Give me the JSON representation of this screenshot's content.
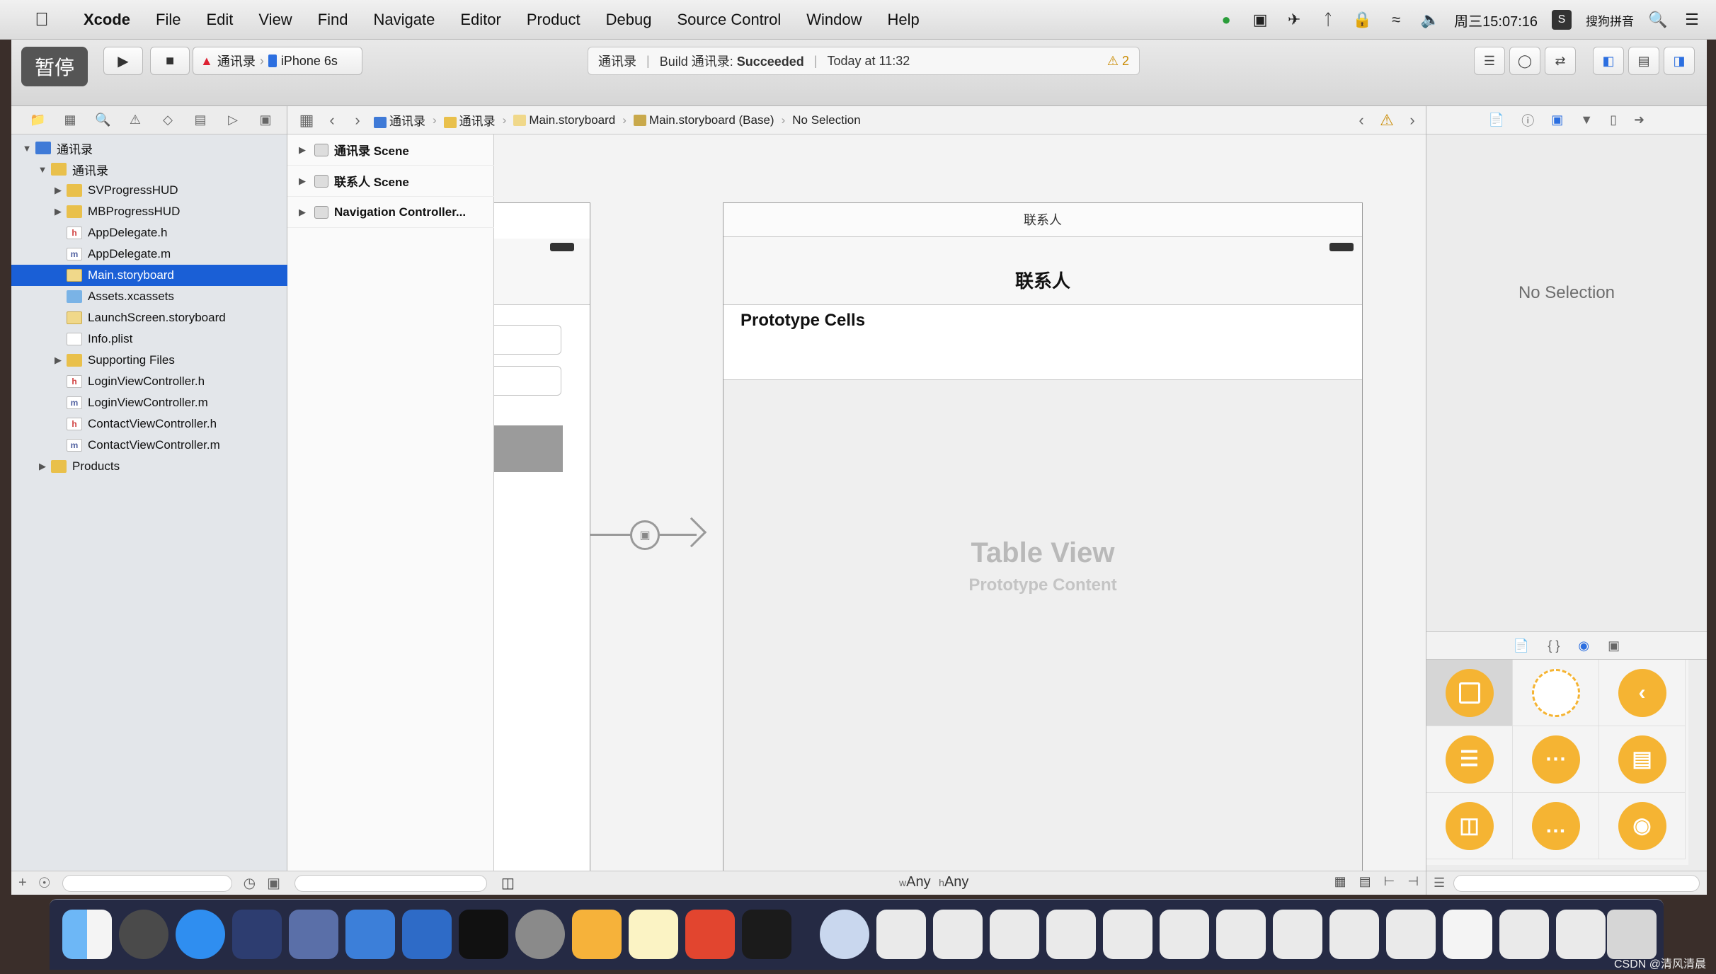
{
  "menubar": {
    "app": "Xcode",
    "menus": [
      "File",
      "Edit",
      "View",
      "Find",
      "Navigate",
      "Editor",
      "Product",
      "Debug",
      "Source Control",
      "Window",
      "Help"
    ],
    "clock": "周三15:07:16",
    "input_method": "搜狗拼音"
  },
  "toolbar": {
    "pause_label": "暂停",
    "scheme": "通讯录",
    "device": "iPhone 6s",
    "activity_project": "通讯录",
    "activity_build_prefix": "Build 通讯录:",
    "activity_status": "Succeeded",
    "activity_time": "Today at 11:32",
    "warning_count": "2"
  },
  "navigator": {
    "items": [
      {
        "label": "通讯录",
        "kind": "proj",
        "level": 0,
        "expanded": true
      },
      {
        "label": "通讯录",
        "kind": "folder",
        "level": 1,
        "expanded": true
      },
      {
        "label": "SVProgressHUD",
        "kind": "folder",
        "level": 2,
        "expanded": false
      },
      {
        "label": "MBProgressHUD",
        "kind": "folder",
        "level": 2,
        "expanded": false
      },
      {
        "label": "AppDelegate.h",
        "kind": "h",
        "level": 2
      },
      {
        "label": "AppDelegate.m",
        "kind": "m",
        "level": 2
      },
      {
        "label": "Main.storyboard",
        "kind": "sb",
        "level": 2,
        "selected": true
      },
      {
        "label": "Assets.xcassets",
        "kind": "xc",
        "level": 2
      },
      {
        "label": "LaunchScreen.storyboard",
        "kind": "sb",
        "level": 2
      },
      {
        "label": "Info.plist",
        "kind": "plist",
        "level": 2
      },
      {
        "label": "Supporting Files",
        "kind": "folder",
        "level": 2,
        "expanded": false
      },
      {
        "label": "LoginViewController.h",
        "kind": "h",
        "level": 2
      },
      {
        "label": "LoginViewController.m",
        "kind": "m",
        "level": 2
      },
      {
        "label": "ContactViewController.h",
        "kind": "h",
        "level": 2
      },
      {
        "label": "ContactViewController.m",
        "kind": "m",
        "level": 2
      },
      {
        "label": "Products",
        "kind": "folder",
        "level": 1,
        "expanded": false
      }
    ]
  },
  "jumpbar": {
    "crumbs": [
      "通讯录",
      "通讯录",
      "Main.storyboard",
      "Main.storyboard (Base)",
      "No Selection"
    ],
    "warning_count": ""
  },
  "outline": {
    "scenes": [
      "通讯录 Scene",
      "联系人 Scene",
      "Navigation Controller..."
    ]
  },
  "canvas": {
    "scene_dock_title": "联系人",
    "nav_title": "联系人",
    "prototype_cells": "Prototype Cells",
    "table_view": "Table View",
    "prototype_content": "Prototype Content",
    "size_w_prefix": "w",
    "size_w": "Any",
    "size_h_prefix": "h",
    "size_h": "Any"
  },
  "utilities": {
    "no_selection": "No Selection"
  },
  "dock": {
    "watermark": "CSDN @清风清晨"
  },
  "colors": {
    "selection": "#1a5fd6",
    "accent": "#2c6fe0",
    "library_object": "#f5b433",
    "warning": "#c98a00"
  }
}
